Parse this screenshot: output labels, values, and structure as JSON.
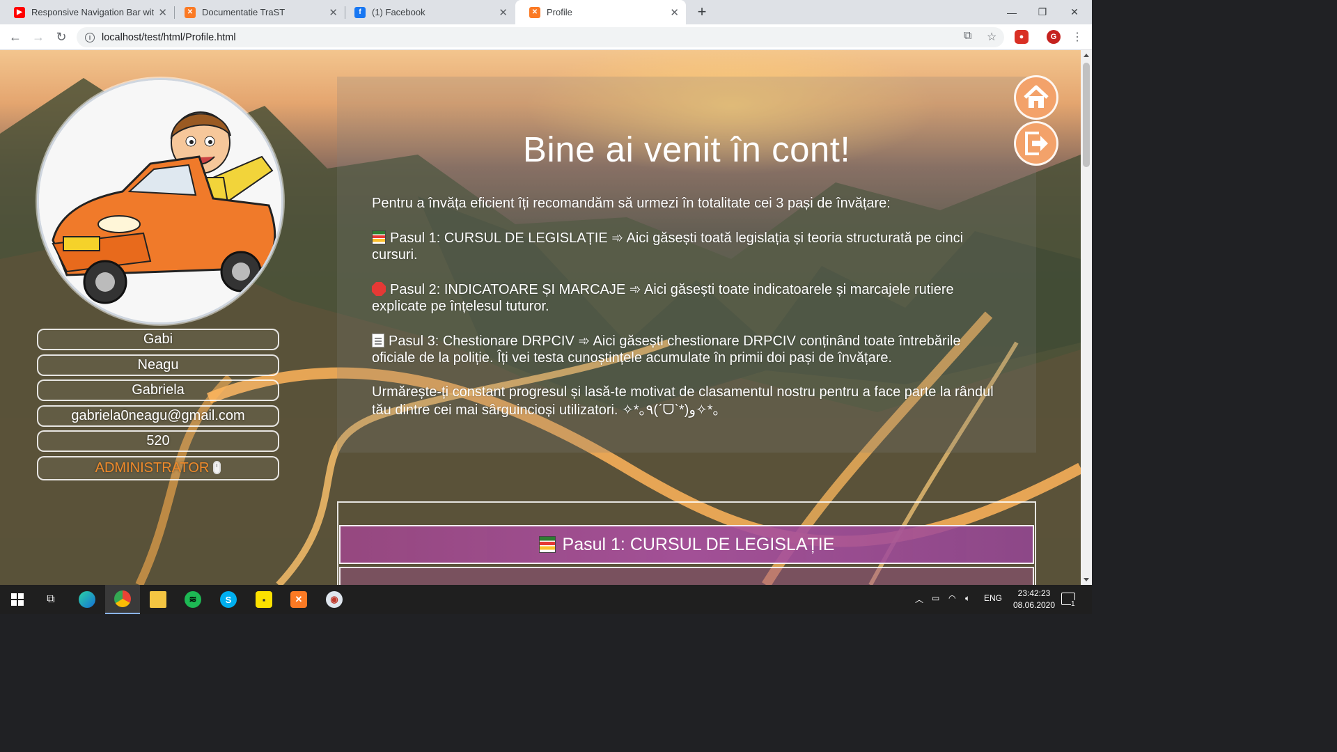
{
  "browser": {
    "tabs": [
      {
        "title": "Responsive Navigation Bar with H",
        "icon": "youtube-icon",
        "active": false
      },
      {
        "title": "Documentatie TraST",
        "icon": "xampp-icon",
        "active": false
      },
      {
        "title": "(1) Facebook",
        "icon": "facebook-icon",
        "active": false
      },
      {
        "title": "Profile",
        "icon": "xampp-icon",
        "active": true
      }
    ],
    "address": "localhost/test/html/Profile.html",
    "profile_initial": "G"
  },
  "profile": {
    "username": "Gabi",
    "last_name": "Neagu",
    "first_name": "Gabriela",
    "email": "gabriela0neagu@gmail.com",
    "score": "520",
    "role": "ADMINISTRATOR"
  },
  "main": {
    "title": "Bine ai venit în cont!",
    "intro": "Pentru a învăța eficient îți recomandăm să urmezi în totalitate cei 3 pași de învățare:",
    "step1": "Pasul 1: CURSUL DE LEGISLAȚIE ➾ Aici găsești toată legislația și teoria structurată pe cinci cursuri.",
    "step2": "Pasul 2: INDICATOARE ȘI MARCAJE ➾ Aici găsești toate indicatoarele și marcajele rutiere explicate pe înțelesul tuturor.",
    "step3": "Pasul 3: Chestionare DRPCIV ➾ Aici găsești chestionare DRPCIV conținând toate întrebările oficiale de la poliție. Îți vei testa cunoștințele acumulate în primii doi pași de învățare.",
    "outro": "Urmărește-ți constant progresul și lasă-te motivat de clasamentul nostru pentru a face parte la rândul tău dintre cei mai sârguincioși utilizatori. ✧*｡٩(ˊᗜˋ*)و✧*｡",
    "step_banner": "Pasul 1: CURSUL DE LEGISLAȚIE"
  },
  "taskbar": {
    "language": "ENG",
    "time": "23:42:23",
    "date": "08.06.2020",
    "notification_count": "1"
  },
  "colors": {
    "accent_orange": "#f3a26a",
    "role_color": "#f08a2a",
    "banner": "#a0468c"
  }
}
